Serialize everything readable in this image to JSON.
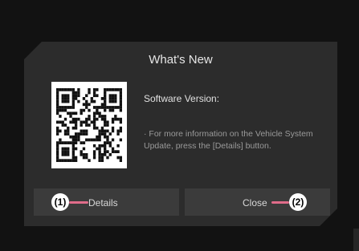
{
  "dialog": {
    "title": "What's New",
    "software_version_label": "Software Version:",
    "note": "· For more information on the Vehicle System Update, press the [Details] button."
  },
  "buttons": {
    "details": {
      "label": "Details",
      "callout": "(1)"
    },
    "close": {
      "label": "Close",
      "callout": "(2)"
    }
  },
  "colors": {
    "screen_bg": "#121212",
    "dialog_bg": "#2c2c2c",
    "button_bg": "#3b3b3b",
    "callout_leader": "#e06c8a"
  },
  "icons": {
    "qr": "qr-code-icon"
  }
}
